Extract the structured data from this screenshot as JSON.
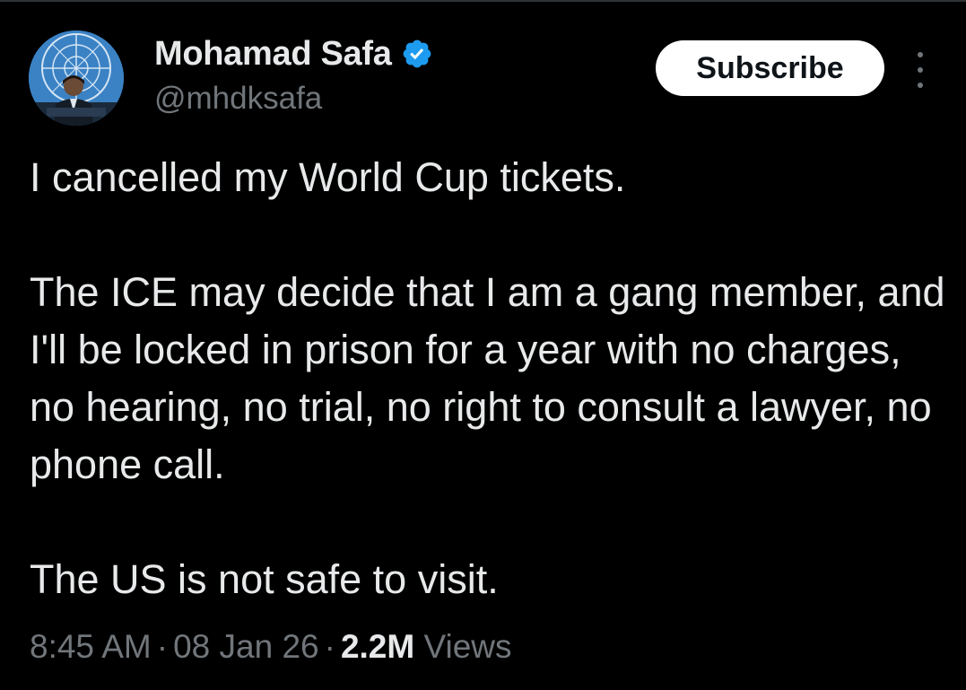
{
  "author": {
    "display_name": "Mohamad Safa",
    "handle": "@mhdksafa",
    "verified": true,
    "verified_badge_color": "#1d9bf0"
  },
  "actions": {
    "subscribe_label": "Subscribe",
    "more_icon": "more-vertical-icon"
  },
  "tweet": {
    "paragraphs": [
      "I cancelled my World Cup tickets.",
      "The ICE may decide that I am a gang member, and I'll be locked in prison for a year with no charges, no hearing, no trial, no right to consult a lawyer, no phone call.",
      "The US is not safe to visit."
    ]
  },
  "meta": {
    "time": "8:45 AM",
    "separator": "·",
    "date": "08 Jan 26",
    "views_count": "2.2M",
    "views_label": "Views"
  },
  "colors": {
    "background": "#000000",
    "text_primary": "#e7e9ea",
    "text_secondary": "#71767b",
    "button_bg": "#ffffff",
    "button_text": "#0f1419"
  }
}
